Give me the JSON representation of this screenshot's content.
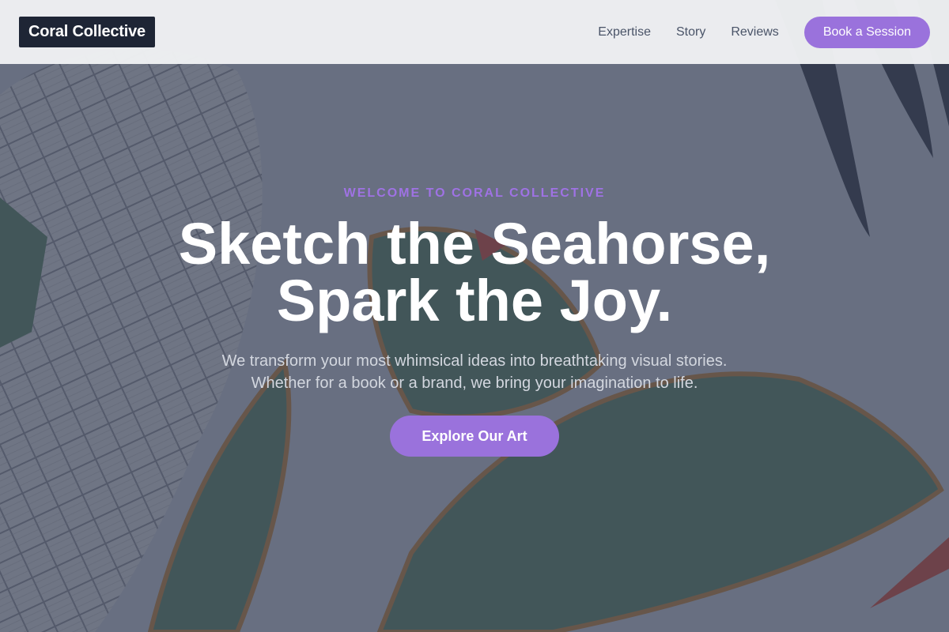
{
  "header": {
    "logo": "Coral Collective",
    "nav": [
      "Expertise",
      "Story",
      "Reviews"
    ],
    "cta_label": "Book a Session"
  },
  "hero": {
    "eyebrow": "WELCOME TO CORAL COLLECTIVE",
    "headline_line1": "Sketch the Seahorse,",
    "headline_line2": "Spark the Joy.",
    "subtext_line1": "We transform your most whimsical ideas into breathtaking visual stories.",
    "subtext_line2": "Whether for a book or a brand, we bring your imagination to life.",
    "button_label": "Explore Our Art",
    "background_image": "seahorse-coral-illustration"
  },
  "colors": {
    "accent": "#9a72dc",
    "eyebrow": "#9f72e4",
    "logo_bg": "#1e2535",
    "header_bg": "#f0f1f3",
    "nav_text": "#4a5468",
    "overlay": "#3a4054"
  }
}
